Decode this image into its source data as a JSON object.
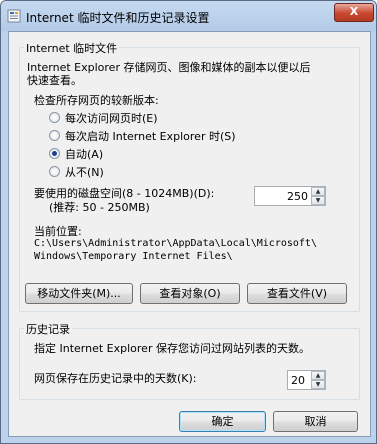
{
  "window": {
    "title": "Internet 临时文件和历史记录设置",
    "close_glyph": "X"
  },
  "temp_files": {
    "group_title": "Internet 临时文件",
    "description_line1": "Internet Explorer 存储网页、图像和媒体的副本以便以后",
    "description_line2": "快速查看。",
    "check_label": "检查所存网页的较新版本:",
    "options": [
      {
        "label": "每次访问网页时(E)",
        "checked": false
      },
      {
        "label": "每次启动 Internet Explorer 时(S)",
        "checked": false
      },
      {
        "label": "自动(A)",
        "checked": true
      },
      {
        "label": "从不(N)",
        "checked": false
      }
    ],
    "disk_space_label": "要使用的磁盘空间(8 - 1024MB)(D):",
    "disk_space_hint": "(推荐: 50 - 250MB)",
    "disk_space_value": "250",
    "location_label": "当前位置:",
    "location_line1": "C:\\Users\\Administrator\\AppData\\Local\\Microsoft\\",
    "location_line2": "Windows\\Temporary Internet Files\\",
    "buttons": {
      "move_folder": "移动文件夹(M)...",
      "view_objects": "查看对象(O)",
      "view_files": "查看文件(V)"
    }
  },
  "history": {
    "group_title": "历史记录",
    "description": "指定 Internet Explorer 保存您访问过网站列表的天数。",
    "days_label": "网页保存在历史记录中的天数(K):",
    "days_value": "20"
  },
  "footer": {
    "ok_label": "确定",
    "cancel_label": "取消"
  }
}
